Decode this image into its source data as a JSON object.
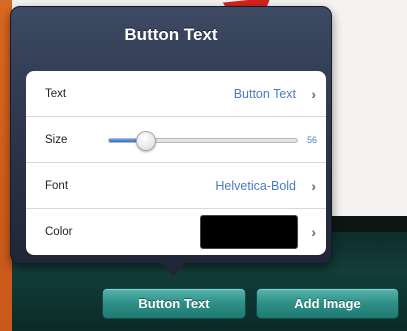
{
  "popover": {
    "title": "Button Text",
    "rows": {
      "text": {
        "label": "Text",
        "value": "Button Text"
      },
      "size": {
        "label": "Size",
        "value": "56",
        "level": 0.2
      },
      "font": {
        "label": "Font",
        "value": "Helvetica-Bold"
      },
      "color": {
        "label": "Color",
        "swatch_color": "#000000"
      }
    },
    "chevron_glyph": "›"
  },
  "toolbar": {
    "button_text_label": "Button Text",
    "add_image_label": "Add Image"
  },
  "colors": {
    "accent_blue": "#4a7cc4",
    "annotation_arrow": "#d2231c",
    "toolbar_button": "#2e8f87"
  }
}
